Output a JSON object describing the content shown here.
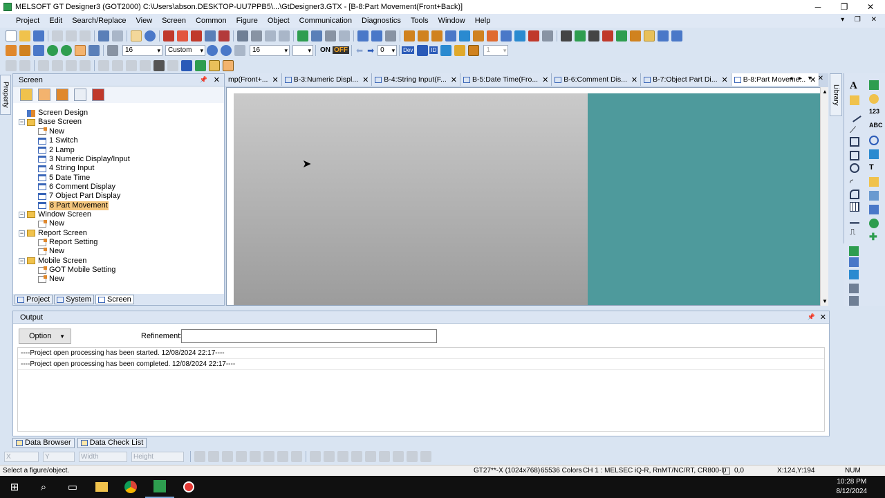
{
  "window": {
    "title": "MELSOFT GT Designer3 (GOT2000) C:\\Users\\abson.DESKTOP-UU7PPB5\\...\\GtDesigner3.GTX - [B-8:Part Movement(Front+Back)]",
    "minimize": "─",
    "restore": "❐",
    "close": "✕"
  },
  "menu": [
    "Project",
    "Edit",
    "Search/Replace",
    "View",
    "Screen",
    "Common",
    "Figure",
    "Object",
    "Communication",
    "Diagnostics",
    "Tools",
    "Window",
    "Help"
  ],
  "mdi_controls": "▾ ❐ ✕",
  "toolbar": {
    "font_size": "16",
    "text_style": "Custom",
    "font_size2": "16",
    "on_label": "ON",
    "off_label": "OFF",
    "step_value": "0",
    "layer_value": "1",
    "dev_label": "Dev",
    "id_label": "ID"
  },
  "property_tab": "Property",
  "library_tab": "Library",
  "screen_panel": {
    "title": "Screen",
    "pin": "📌",
    "close": "✕",
    "tree": [
      {
        "label": "Screen Design",
        "level": 0,
        "icon": "design"
      },
      {
        "label": "Base Screen",
        "level": 0,
        "icon": "folder",
        "expander": "−"
      },
      {
        "label": "New",
        "level": 1,
        "icon": "new"
      },
      {
        "label": "1 Switch",
        "level": 1,
        "icon": "page"
      },
      {
        "label": "2 Lamp",
        "level": 1,
        "icon": "page"
      },
      {
        "label": "3 Numeric Display/Input",
        "level": 1,
        "icon": "page"
      },
      {
        "label": "4 String Input",
        "level": 1,
        "icon": "page"
      },
      {
        "label": "5 Date Time",
        "level": 1,
        "icon": "page"
      },
      {
        "label": "6 Comment Display",
        "level": 1,
        "icon": "page"
      },
      {
        "label": "7 Object Part Display",
        "level": 1,
        "icon": "page"
      },
      {
        "label": "8 Part Movement",
        "level": 1,
        "icon": "page",
        "selected": true
      },
      {
        "label": "Window Screen",
        "level": 0,
        "icon": "folder",
        "expander": "−"
      },
      {
        "label": "New",
        "level": 1,
        "icon": "new"
      },
      {
        "label": "Report Screen",
        "level": 0,
        "icon": "folder",
        "expander": "−"
      },
      {
        "label": "Report Setting",
        "level": 1,
        "icon": "new"
      },
      {
        "label": "New",
        "level": 1,
        "icon": "new"
      },
      {
        "label": "Mobile Screen",
        "level": 0,
        "icon": "folder",
        "expander": "−"
      },
      {
        "label": "GOT Mobile Setting",
        "level": 1,
        "icon": "new"
      },
      {
        "label": "New",
        "level": 1,
        "icon": "new"
      }
    ],
    "tabs": [
      "Project",
      "System",
      "Screen"
    ]
  },
  "doc_tabs": [
    {
      "label": "mp(Front+...",
      "close": "✕"
    },
    {
      "label": "B-3:Numeric Displ...",
      "close": "✕"
    },
    {
      "label": "B-4:String Input(F...",
      "close": "✕"
    },
    {
      "label": "B-5:Date Time(Fro...",
      "close": "✕"
    },
    {
      "label": "B-6:Comment Dis...",
      "close": "✕"
    },
    {
      "label": "B-7:Object Part Di...",
      "close": "✕"
    },
    {
      "label": "B-8:Part Moveme...",
      "close": "✕",
      "active": true
    }
  ],
  "doc_nav": "◂ ▸ ▾ ✕",
  "output": {
    "title": "Output",
    "option_label": "Option",
    "refinement_label": "Refinement:",
    "refinement_value": "",
    "log": [
      "----Project open processing has been started.  12/08/2024 22:17----",
      "----Project open processing has been completed.  12/08/2024 22:17----"
    ]
  },
  "bottom_tabs": [
    "Data Browser",
    "Data Check List"
  ],
  "coord_fields": [
    "X",
    "Y",
    "Width",
    "Height"
  ],
  "status": {
    "hint": "Select a figure/object.",
    "got_type": "GT27**-X (1024x768)",
    "colors": "65536 Colors",
    "channel": "CH 1 : MELSEC iQ-R, RnMT/NC/RT, CR800-D",
    "position": "0,0",
    "cursor": "X:124,Y:194",
    "num": "NUM"
  },
  "taskbar": {
    "time": "10:28 PM",
    "date": "8/12/2024"
  },
  "colors": {
    "canvas_gray": "#b4b4b4",
    "canvas_teal": "#4e9a9c",
    "selection": "#f5c77e"
  }
}
